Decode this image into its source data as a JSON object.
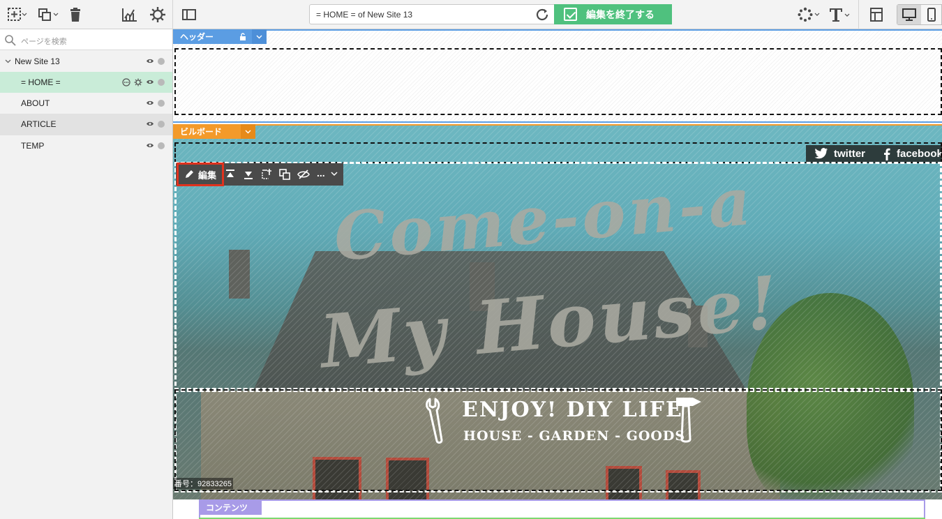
{
  "toolbar": {
    "url": "= HOME = of New Site 13",
    "finish_label": "編集を終了する",
    "icons": [
      "add-page-icon",
      "duplicate-icon",
      "trash-icon",
      "analytics-icon",
      "settings-icon",
      "sidebar-toggle-icon",
      "reload-icon",
      "loading-icon",
      "text-style-icon",
      "layout-icon",
      "desktop-icon",
      "mobile-icon"
    ]
  },
  "sidebar": {
    "search_placeholder": "ページを検索",
    "site_name": "New Site 13",
    "pages": [
      {
        "label": "= HOME ="
      },
      {
        "label": "ABOUT"
      },
      {
        "label": "ARTICLE"
      },
      {
        "label": "TEMP"
      }
    ]
  },
  "canvas": {
    "header_tag": "ヘッダー",
    "billboard_tag": "ビルボード",
    "contents_tag": "コンテンツ",
    "social": {
      "twitter": "twitter",
      "facebook": "facebook"
    },
    "headline_1": "Come-on-a",
    "headline_2": "My House!",
    "diy_title": "ENJOY! DIY LIFE",
    "diy_subtitle": "HOUSE - GARDEN - GOODS",
    "edit_label": "編集",
    "more_label": "...",
    "serial": "番号：92833265"
  },
  "colors": {
    "header_blue": "#5b9de3",
    "billboard_orange": "#f39a2a",
    "contents_purple": "#a89be8",
    "finish_green": "#4fc17e",
    "active_row": "#c9ecd8",
    "edit_highlight": "#e0321e"
  }
}
